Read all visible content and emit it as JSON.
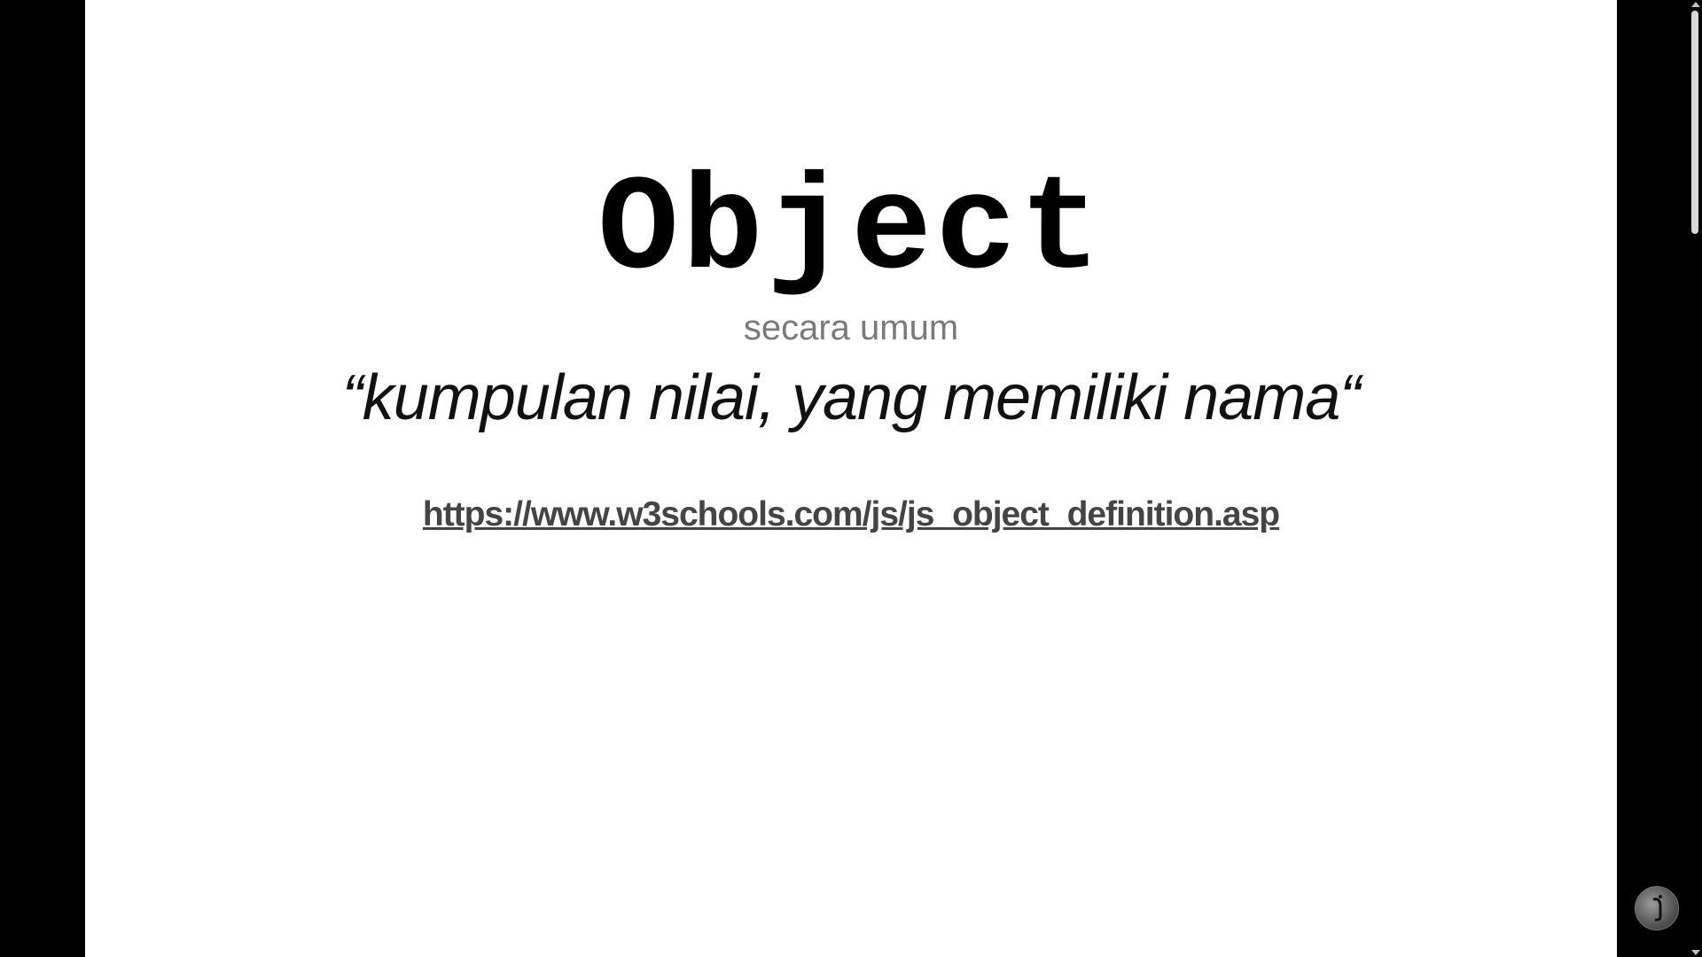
{
  "slide": {
    "title": "Object",
    "subtitle": "secara umum",
    "quote": "“kumpulan nilai, yang memiliki nama“",
    "link_text": "https://www.w3schools.com/js/js_object_definition.asp"
  },
  "icons": {
    "corner_badge": "avatar-badge-icon"
  },
  "colors": {
    "background": "#000000",
    "slide": "#ffffff",
    "subtitle": "#7a7a7a",
    "link": "#444444"
  }
}
